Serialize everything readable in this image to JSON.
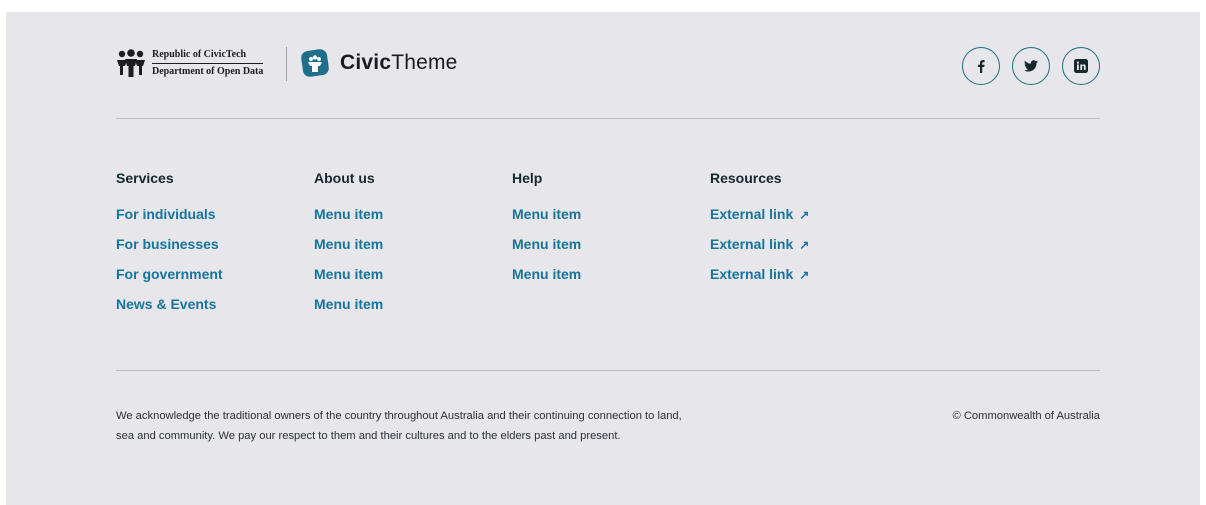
{
  "brand": {
    "gov_line1": "Republic of CivicTech",
    "gov_line2": "Department of Open Data",
    "civic_bold": "Civic",
    "civic_light": "Theme",
    "civic_color": "#1e6e8c"
  },
  "socials": [
    {
      "icon": "facebook-icon",
      "glyph": "f"
    },
    {
      "icon": "twitter-icon"
    },
    {
      "icon": "linkedin-icon"
    }
  ],
  "menus": {
    "services": {
      "title": "Services",
      "items": [
        "For individuals",
        "For businesses",
        "For government",
        "News & Events"
      ]
    },
    "about": {
      "title": "About us",
      "items": [
        "Menu item",
        "Menu item",
        "Menu item",
        "Menu item"
      ]
    },
    "help": {
      "title": "Help",
      "items": [
        "Menu item",
        "Menu item",
        "Menu item"
      ]
    },
    "resources": {
      "title": "Resources",
      "items": [
        "External link",
        "External link",
        "External link"
      ],
      "external_icon": "↗"
    }
  },
  "acknowledgement": "We acknowledge the traditional owners of the country throughout Australia and their continuing connection to land, sea and community. We pay our respect to them and their cultures and to the elders past and present.",
  "copyright": "© Commonwealth of Australia",
  "colors": {
    "background": "#e6e6eb",
    "link": "#17749a",
    "heading": "#14282e",
    "accent": "#1e6e82"
  }
}
